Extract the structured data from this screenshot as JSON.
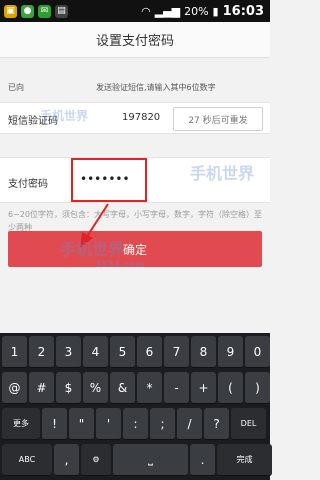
{
  "status_bar": {
    "battery": "20%",
    "time": "16:03",
    "icons": [
      "sim-icon",
      "game-icon",
      "message-icon",
      "gallery-icon",
      "wifi-icon",
      "signal-icon",
      "battery-icon"
    ]
  },
  "header": {
    "title": "设置支付密码"
  },
  "notice": {
    "prefix": "已向",
    "suffix": "发送验证短信,请输入其中6位数字"
  },
  "verify": {
    "label": "短信验证码",
    "value": "197820",
    "resend_button": "27 秒后可重发"
  },
  "password": {
    "label": "支付密码",
    "value": "•••••••"
  },
  "hint": "6~20位字符，须包含：大写字母，小写字母，数字，字符（除空格）至少两种",
  "confirm_button": "确定",
  "watermarks": [
    "手机世界",
    "3533.com"
  ],
  "keyboard": {
    "row1": [
      "1",
      "2",
      "3",
      "4",
      "5",
      "6",
      "7",
      "8",
      "9",
      "0"
    ],
    "row2": [
      "@",
      "#",
      "$",
      "%",
      "&",
      "*",
      "-",
      "+",
      "(",
      ")"
    ],
    "row3": [
      "更多",
      "!",
      "\"",
      "'",
      ":",
      ";",
      "/",
      "?",
      "DEL"
    ],
    "row4": [
      "ABC",
      ",",
      "",
      "",
      ".",
      "完成"
    ]
  },
  "colors": {
    "accent": "#e04a50",
    "highlight": "#e02424",
    "keyboard_bg": "#1a1c1f"
  }
}
